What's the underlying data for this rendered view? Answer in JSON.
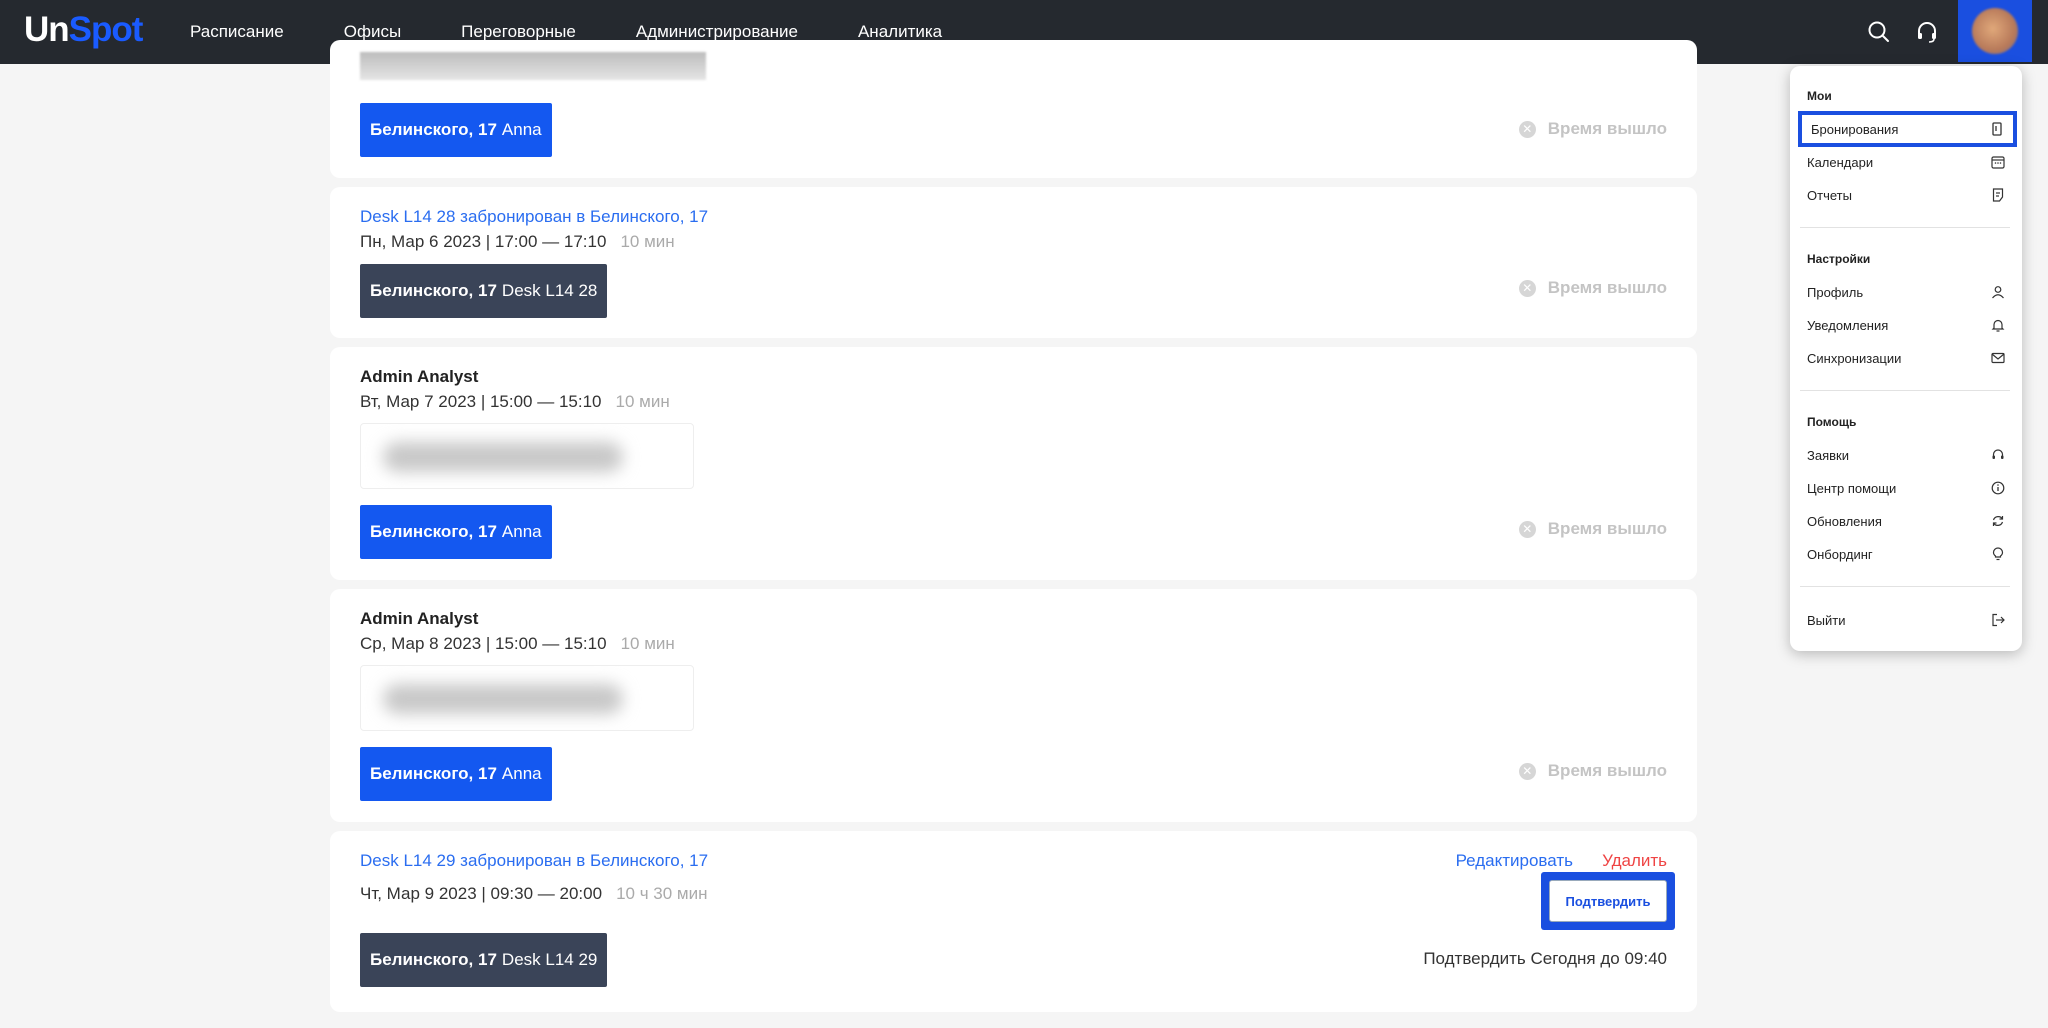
{
  "header": {
    "logo_prefix": "Un",
    "logo_suffix": "Spot",
    "nav": [
      "Расписание",
      "Офисы",
      "Переговорные",
      "Администрирование",
      "Аналитика"
    ],
    "icons": [
      "search-icon",
      "headset-icon",
      "avatar"
    ]
  },
  "bookings": [
    {
      "tag_location": "Белинского, 17",
      "tag_name": "Anna",
      "status": "Время вышло"
    },
    {
      "title": "Desk L14 28 забронирован в Белинского, 17",
      "datetime": "Пн, Мар 6 2023 | 17:00 — 17:10",
      "duration": "10 мин",
      "tag_location": "Белинского, 17",
      "tag_name": "Desk L14 28",
      "status": "Время вышло"
    },
    {
      "title": "Admin Analyst",
      "datetime": "Вт, Мар 7 2023 | 15:00 — 15:10",
      "duration": "10 мин",
      "tag_location": "Белинского, 17",
      "tag_name": "Anna",
      "status": "Время вышло"
    },
    {
      "title": "Admin Analyst",
      "datetime": "Ср, Мар 8 2023 | 15:00 — 15:10",
      "duration": "10 мин",
      "tag_location": "Белинского, 17",
      "tag_name": "Anna",
      "status": "Время вышло"
    },
    {
      "title": "Desk L14 29 забронирован в Белинского, 17",
      "datetime": "Чт, Мар 9 2023 | 09:30 — 20:00",
      "duration": "10 ч 30 мин",
      "tag_location": "Белинского, 17",
      "tag_name": "Desk L14 29",
      "edit_label": "Редактировать",
      "delete_label": "Удалить",
      "confirm_label": "Подтвердить",
      "confirm_until": "Подтвердить Сегодня до 09:40"
    }
  ],
  "menu": {
    "section_mine": "Мои",
    "mine_items": [
      {
        "label": "Бронирования",
        "icon": "bookmark-icon",
        "active": true
      },
      {
        "label": "Календари",
        "icon": "calendar-icon"
      },
      {
        "label": "Отчеты",
        "icon": "report-icon"
      }
    ],
    "section_settings": "Настройки",
    "settings_items": [
      {
        "label": "Профиль",
        "icon": "user-icon"
      },
      {
        "label": "Уведомления",
        "icon": "bell-icon"
      },
      {
        "label": "Синхронизации",
        "icon": "mail-icon"
      }
    ],
    "section_help": "Помощь",
    "help_items": [
      {
        "label": "Заявки",
        "icon": "headset-icon"
      },
      {
        "label": "Центр помощи",
        "icon": "info-icon"
      },
      {
        "label": "Обновления",
        "icon": "refresh-icon"
      },
      {
        "label": "Онбординг",
        "icon": "lightbulb-icon"
      }
    ],
    "logout_label": "Выйти",
    "logout_icon": "logout-icon"
  },
  "colors": {
    "topbar": "#25292f",
    "accent": "#1a4fe0",
    "tag_blue": "#1458f0",
    "tag_dark": "#3a4458",
    "link": "#2a6df0",
    "danger": "#ef4444"
  }
}
